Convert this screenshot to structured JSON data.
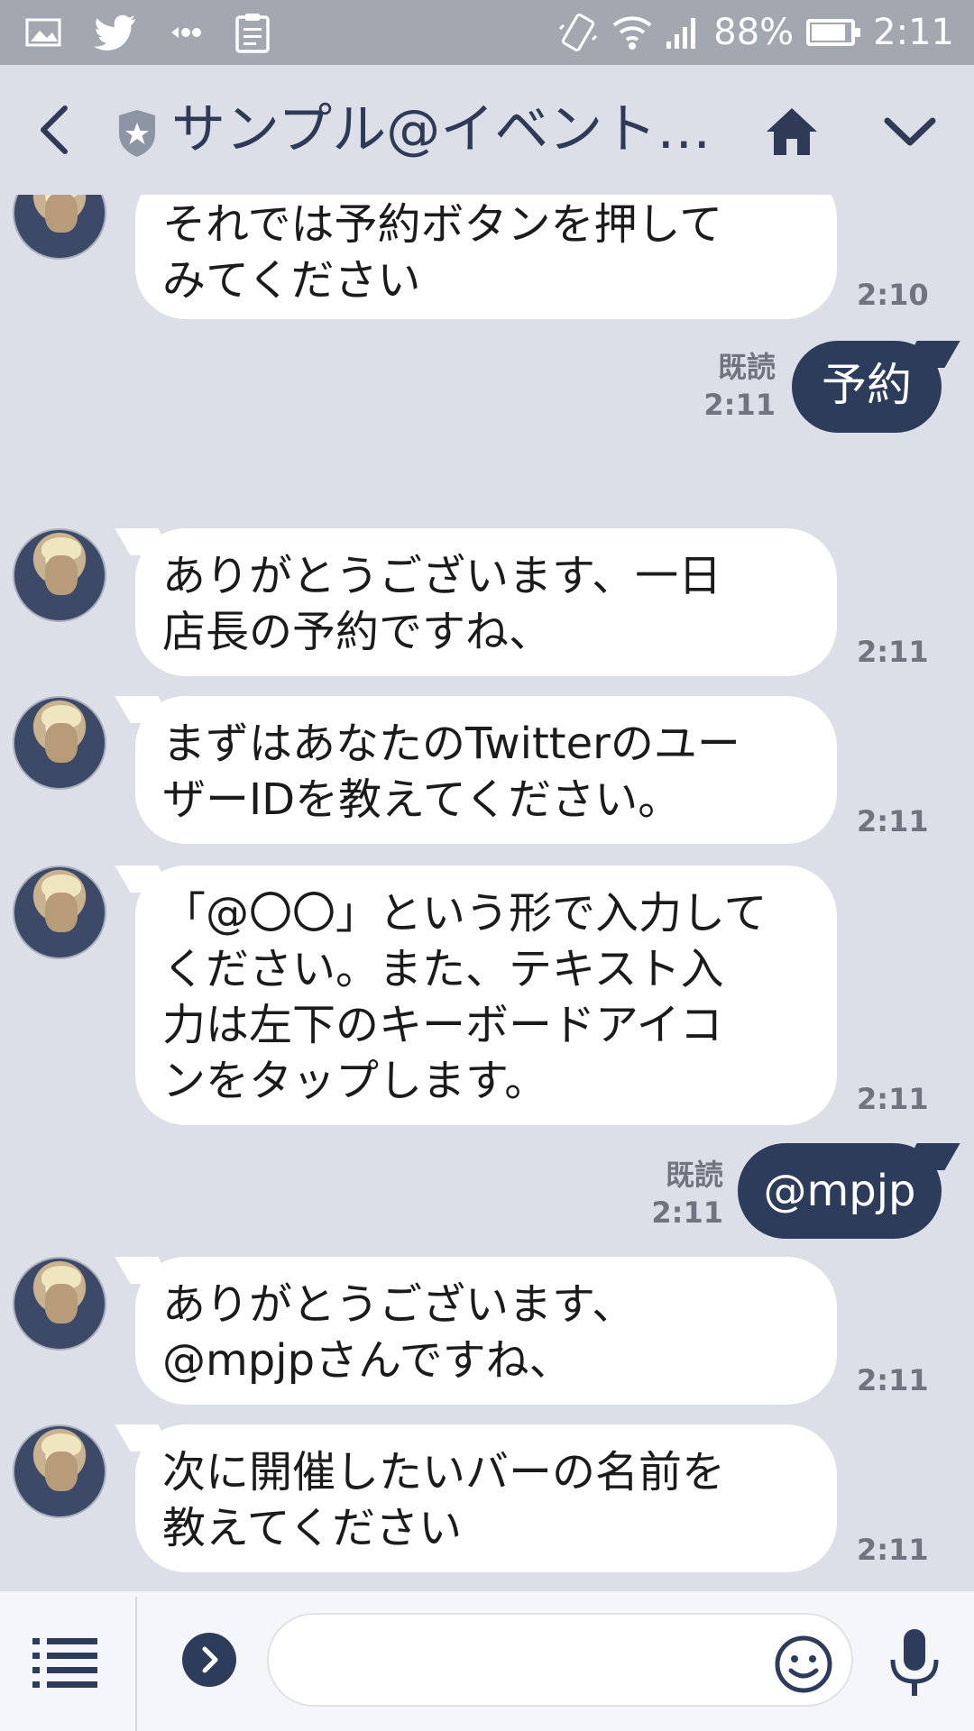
{
  "status_bar": {
    "left_icons": [
      "image-icon",
      "twitter-icon",
      "dots-icon",
      "clipboard-icon"
    ],
    "right_icons": [
      "vibrate-icon",
      "wifi-icon",
      "signal-icon"
    ],
    "battery_text": "88%",
    "battery_level": 0.88,
    "time": "2:11"
  },
  "header": {
    "title": "サンプル@イベント…"
  },
  "messages": [
    {
      "sender": "other",
      "text": "それでは予約ボタンを押して\nみてください",
      "time": "2:10"
    },
    {
      "sender": "me",
      "text": "予約",
      "read_label": "既読",
      "time": "2:11"
    },
    {
      "sender": "other",
      "text": "ありがとうございます、一日\n店長の予約ですね、",
      "time": "2:11"
    },
    {
      "sender": "other",
      "text": "まずはあなたのTwitterのユー\nザーIDを教えてください。",
      "time": "2:11"
    },
    {
      "sender": "other",
      "text": "「@〇〇」という形で入力して\nください。また、テキスト入\n力は左下のキーボードアイコ\nンをタップします。",
      "time": "2:11"
    },
    {
      "sender": "me",
      "text": "@mpjp",
      "read_label": "既読",
      "time": "2:11"
    },
    {
      "sender": "other",
      "text": "ありがとうございます、\n@mpjpさんですね、",
      "time": "2:11"
    },
    {
      "sender": "other",
      "text": "次に開催したいバーの名前を\n教えてください",
      "time": "2:11"
    }
  ],
  "input": {
    "value": ""
  },
  "colors": {
    "background": "#dcdfe8",
    "status_bar": "#a2a7b0",
    "outgoing_bubble": "#2e3c5b",
    "incoming_bubble": "#ffffff",
    "title": "#2f3a57"
  }
}
